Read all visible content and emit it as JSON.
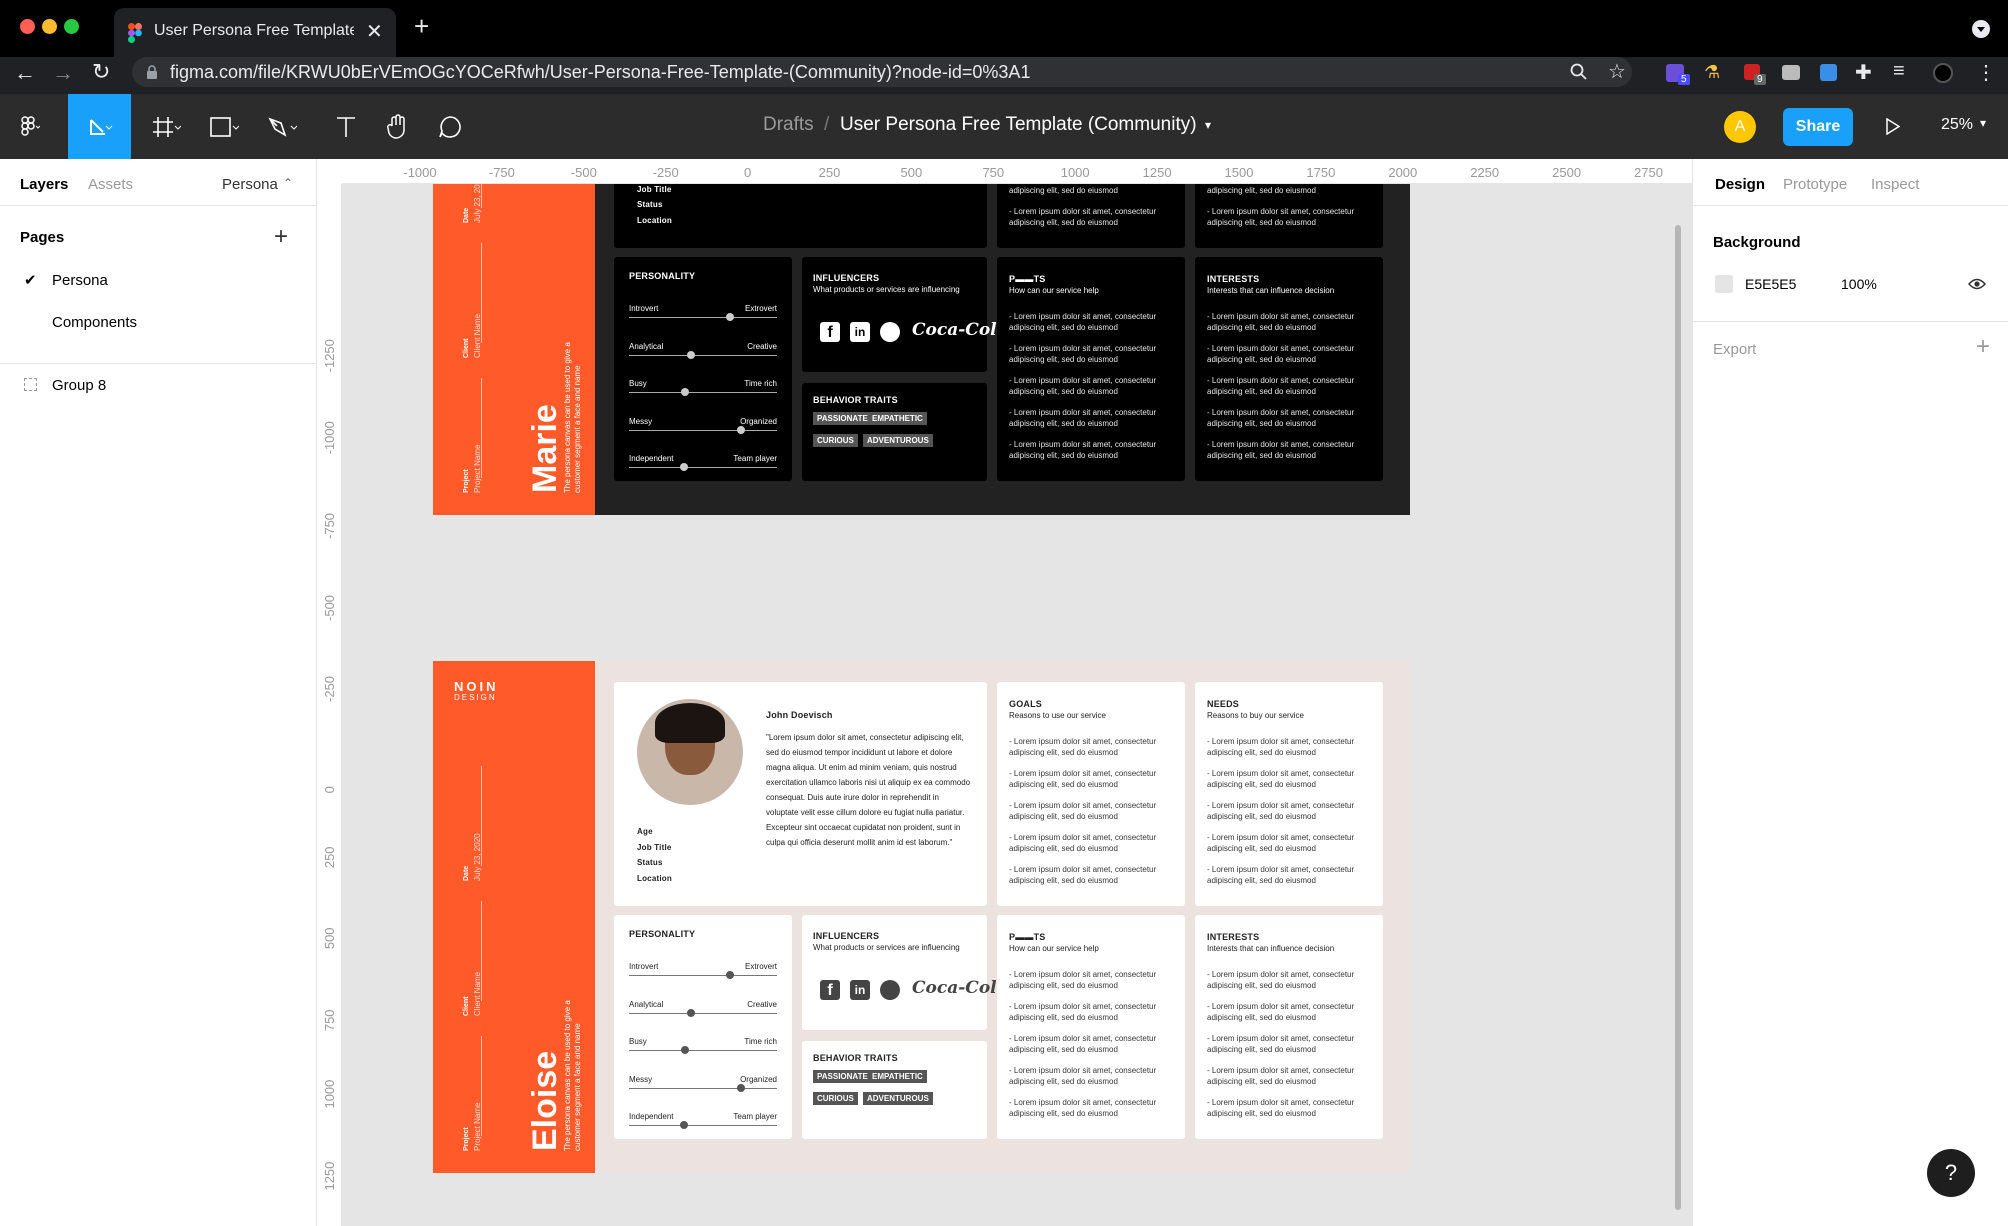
{
  "browser": {
    "tab_title": "User Persona Free Template (C",
    "url": "figma.com/file/KRWU0bErVEmOGcYOCeRfwh/User-Persona-Free-Template-(Community)?node-id=0%3A1",
    "ext_badge_1": "5",
    "ext_badge_2": "9"
  },
  "toolbar": {
    "breadcrumb_root": "Drafts",
    "breadcrumb_sep": "/",
    "file_name": "User Persona Free Template (Community)",
    "avatar_letter": "A",
    "share_label": "Share",
    "zoom": "25%"
  },
  "left_panel": {
    "tab_layers": "Layers",
    "tab_assets": "Assets",
    "page_selector": "Persona",
    "pages_heading": "Pages",
    "pages": [
      "Persona",
      "Components"
    ],
    "layers": [
      "Group 8"
    ]
  },
  "right_panel": {
    "tab_design": "Design",
    "tab_prototype": "Prototype",
    "tab_inspect": "Inspect",
    "background_heading": "Background",
    "bg_hex": "E5E5E5",
    "bg_opacity": "100%",
    "export_heading": "Export",
    "help": "?"
  },
  "rulers": {
    "h": [
      "-1000",
      "-750",
      "-500",
      "-250",
      "0",
      "250",
      "500",
      "750",
      "1000",
      "1250",
      "1500",
      "1750",
      "2000",
      "2250",
      "2500",
      "2750"
    ],
    "v": [
      "-1250",
      "-1000",
      "-750",
      "-500",
      "-250",
      "0",
      "250",
      "500",
      "750",
      "1000",
      "1250",
      "1500"
    ]
  },
  "persona_dark": {
    "name": "Marie",
    "quote": "sed do eiusmod tempor incididunt ut labore et dolore magna aliqua. Ut enim ad minim veniam, quis nostrud exercitation ullamco laboris nisi ut aliquip ex ea commodo consequat. Duis aute irure dolor in reprehendit in voluptate velit esse cillum dolore eu fugiat nulla pariatur. Excepteur sint occaecat cupidatat non proident, sunt in culpa qui officia deserunt mollit anim id est laborum."
  },
  "persona_light": {
    "brand": "NOIN",
    "brand_sub": "DESIGN",
    "name": "Eloise",
    "full_name": "John Doevisch",
    "quote": "\"Lorem ipsum dolor sit amet, consectetur adipiscing elit, sed do eiusmod tempor incididunt ut labore et dolore magna aliqua. Ut enim ad minim veniam, quis nostrud exercitation ullamco laboris nisi ut aliquip ex ea commodo consequat. Duis aute irure dolor in reprehendit in voluptate velit esse cillum dolore eu fugiat nulla pariatur. Excepteur sint occaecat cupidatat non proident, sunt in culpa qui officia deserunt mollit anim id est laborum.\""
  },
  "persona_common": {
    "info_labels": [
      "Age",
      "Job Title",
      "Status",
      "Location"
    ],
    "side_labels": [
      {
        "label": "Date",
        "value": "July 23, 2020"
      },
      {
        "label": "Client",
        "value": "Client Name"
      },
      {
        "label": "Project",
        "value": "Project Name"
      }
    ],
    "tagline": "The persona canvas can be used to give a customer segment a face and name",
    "personality_title": "PERSONALITY",
    "personality": [
      {
        "left": "Introvert",
        "right": "Extrovert",
        "level": 0.68
      },
      {
        "left": "Analytical",
        "right": "Creative",
        "level": 0.42
      },
      {
        "left": "Busy",
        "right": "Time rich",
        "level": 0.38
      },
      {
        "left": "Messy",
        "right": "Organized",
        "level": 0.76
      },
      {
        "left": "Independent",
        "right": "Team player",
        "level": 0.37
      }
    ],
    "influencers_title": "INFLUENCERS",
    "influencers_sub": "What products or services are influencing",
    "coca_cola": "Coca-Cola",
    "traits_title": "BEHAVIOR TRAITS",
    "traits": [
      "PASSIONATE",
      "EMPATHETIC",
      "CURIOUS",
      "ADVENTUROUS"
    ],
    "goals_title": "GOALS",
    "goals_sub": "Reasons to use our service",
    "needs_title": "NEEDS",
    "needs_sub": "Reasons to buy our service",
    "pains_title": "P▬▬TS",
    "pains_sub": "How can our service help",
    "interests_title": "INTERESTS",
    "interests_sub": "Interests that can influence decision",
    "bullet_line1": "- Lorem ipsum dolor sit amet, consectetur",
    "bullet_line2": "adipiscing elit, sed do eiusmod"
  },
  "colors": {
    "figma_blue": "#18a0fb",
    "persona_orange": "#ff5a2a",
    "avatar_yellow": "#ffc700"
  }
}
